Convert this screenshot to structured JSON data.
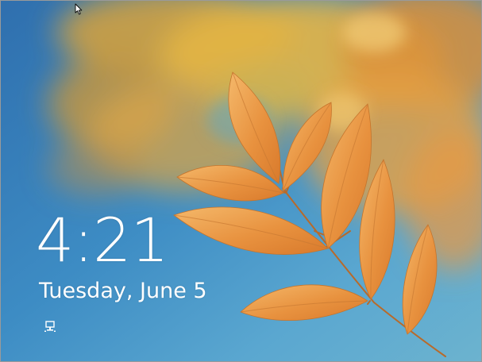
{
  "lock_screen": {
    "time": "4:21",
    "date": "Tuesday, June 5",
    "status_icons": [
      "network-icon"
    ]
  },
  "colors": {
    "sky_blue": "#3f86c0",
    "leaf_orange": "#e89a4a",
    "bokeh_yellow": "#e8b43a",
    "text": "#ffffff"
  },
  "icons": {
    "cursor": "mouse-pointer-icon",
    "network": "network-icon"
  }
}
